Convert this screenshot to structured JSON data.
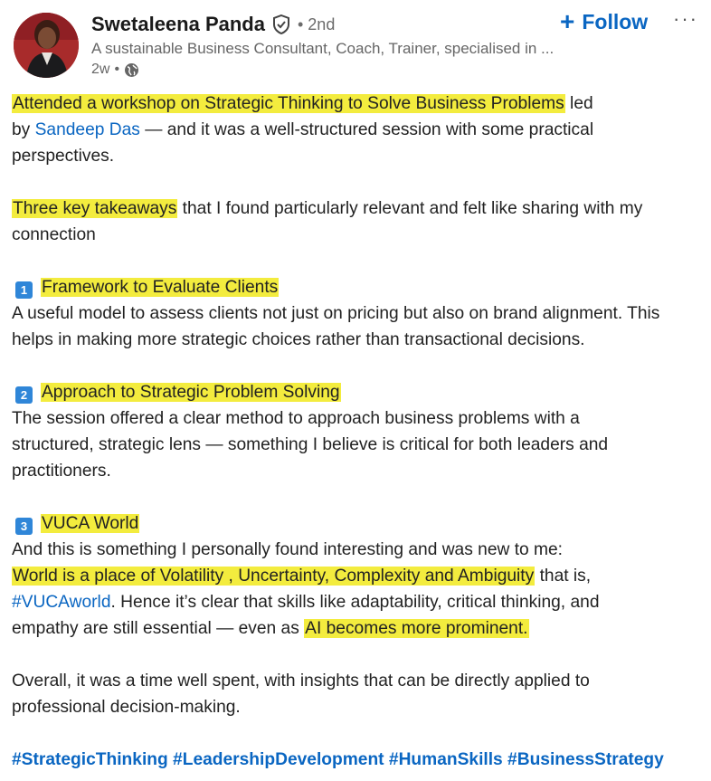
{
  "author": {
    "name": "Swetaleena Panda",
    "degree": "2nd",
    "degree_separator": "•",
    "headline": "A sustainable Business Consultant, Coach, Trainer, specialised in ...",
    "time": "2w",
    "time_separator": "•"
  },
  "actions": {
    "follow_label": "Follow",
    "follow_plus": "+",
    "more_label": "···"
  },
  "post": {
    "p1_highlight": "Attended a workshop on Strategic Thinking to Solve Business Problems",
    "p1_after_highlight": " led",
    "p1_by": "by ",
    "p1_mention": "Sandeep Das",
    "p1_rest": " — and it was a well-structured session with some practical",
    "p1_line3": "perspectives.",
    "p2_highlight": "Three key takeaways",
    "p2_rest": " that I found particularly relevant and felt like sharing with my",
    "p2_line2": "connection",
    "item1_num": "1",
    "item1_title": "Framework to Evaluate Clients",
    "item1_line1": "A useful model to assess clients not just on pricing but also on brand alignment. This",
    "item1_line2": "helps in making more strategic choices rather than transactional decisions.",
    "item2_num": "2",
    "item2_title": "Approach to Strategic Problem Solving",
    "item2_line1": "The session offered a clear method to approach business problems with a",
    "item2_line2": "structured, strategic lens — something I believe is critical for both leaders and",
    "item2_line3": "practitioners.",
    "item3_num": "3",
    "item3_title": "VUCA World",
    "item3_line1": "And this is something I personally found interesting and was new to me:",
    "item3_hl": "World is a place of Volatility , Uncertainty, Complexity and Ambiguity",
    "item3_after_hl": " that is,",
    "item3_hashtag": "#VUCAworld",
    "item3_line3_rest": ". Hence it’s clear that skills like adaptability, critical thinking, and",
    "item3_line4_pre": "empathy are still essential — even as ",
    "item3_line4_hl": "AI becomes more prominent.",
    "closing_line1": "Overall, it was a time well spent, with insights that can be directly applied to",
    "closing_line2": "professional decision-making.",
    "hashtags": "#StrategicThinking #LeadershipDevelopment #HumanSkills #BusinessStrategy"
  },
  "colors": {
    "highlight": "#f3ec3e",
    "link": "#0a66c2",
    "number_badge": "#2f86d8"
  }
}
